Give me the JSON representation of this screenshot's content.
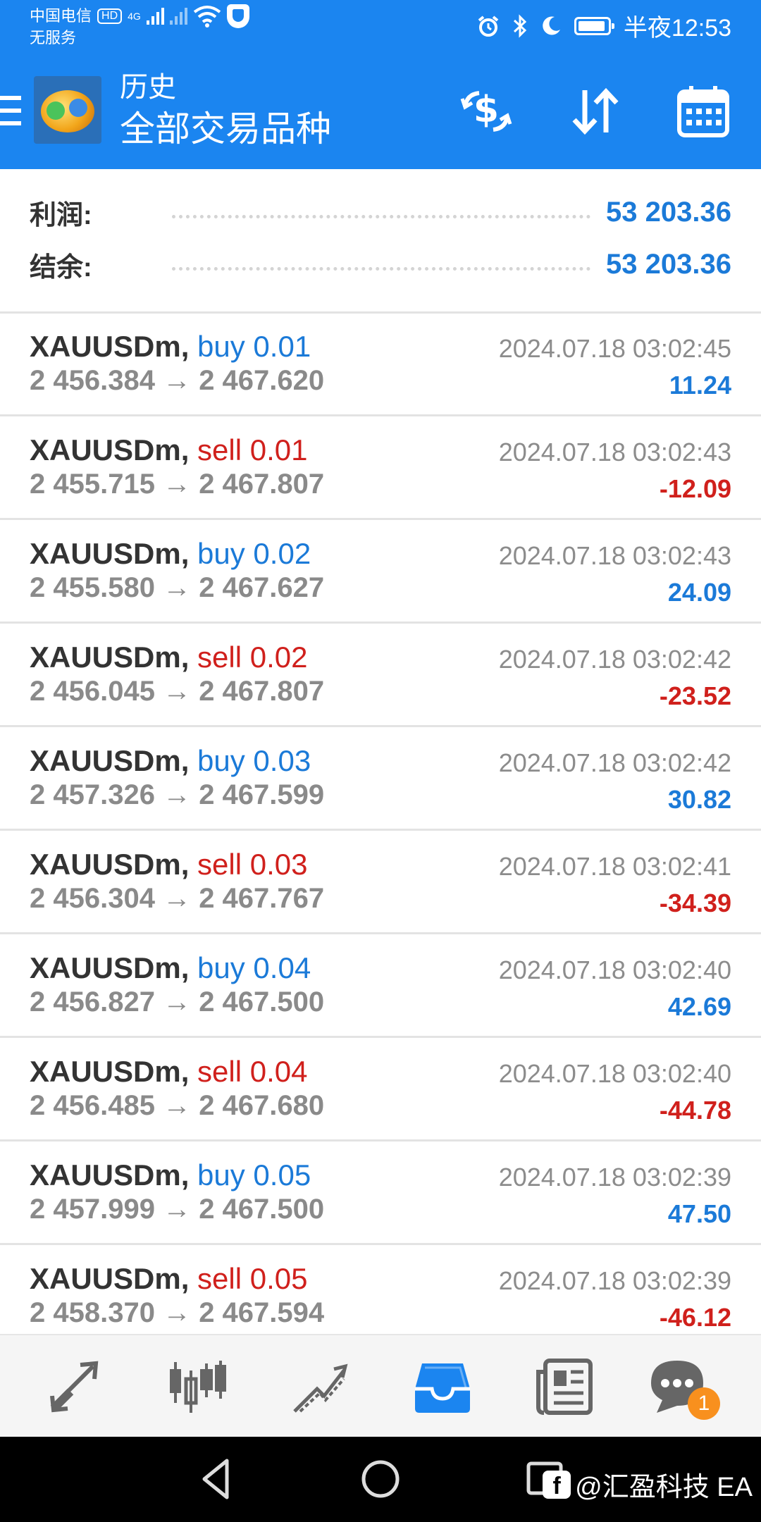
{
  "status_bar": {
    "carrier": "中国电信",
    "hd_badge": "HD",
    "net_type": "4G",
    "service": "无服务",
    "time": "半夜12:53"
  },
  "toolbar": {
    "title": "历史",
    "subtitle": "全部交易品种",
    "icons": [
      "menu-icon",
      "app-logo",
      "dollar-exchange-icon",
      "sort-icon",
      "calendar-icon"
    ]
  },
  "summary": {
    "profit_label": "利润:",
    "profit_value": "53 203.36",
    "balance_label": "结余:",
    "balance_value": "53 203.36"
  },
  "trades": [
    {
      "symbol": "XAUUSDm,",
      "side": "buy 0.01",
      "type": "buy",
      "open": "2 456.384",
      "close": "2 467.620",
      "time": "2024.07.18 03:02:45",
      "profit": "11.24"
    },
    {
      "symbol": "XAUUSDm,",
      "side": "sell 0.01",
      "type": "sell",
      "open": "2 455.715",
      "close": "2 467.807",
      "time": "2024.07.18 03:02:43",
      "profit": "-12.09"
    },
    {
      "symbol": "XAUUSDm,",
      "side": "buy 0.02",
      "type": "buy",
      "open": "2 455.580",
      "close": "2 467.627",
      "time": "2024.07.18 03:02:43",
      "profit": "24.09"
    },
    {
      "symbol": "XAUUSDm,",
      "side": "sell 0.02",
      "type": "sell",
      "open": "2 456.045",
      "close": "2 467.807",
      "time": "2024.07.18 03:02:42",
      "profit": "-23.52"
    },
    {
      "symbol": "XAUUSDm,",
      "side": "buy 0.03",
      "type": "buy",
      "open": "2 457.326",
      "close": "2 467.599",
      "time": "2024.07.18 03:02:42",
      "profit": "30.82"
    },
    {
      "symbol": "XAUUSDm,",
      "side": "sell 0.03",
      "type": "sell",
      "open": "2 456.304",
      "close": "2 467.767",
      "time": "2024.07.18 03:02:41",
      "profit": "-34.39"
    },
    {
      "symbol": "XAUUSDm,",
      "side": "buy 0.04",
      "type": "buy",
      "open": "2 456.827",
      "close": "2 467.500",
      "time": "2024.07.18 03:02:40",
      "profit": "42.69"
    },
    {
      "symbol": "XAUUSDm,",
      "side": "sell 0.04",
      "type": "sell",
      "open": "2 456.485",
      "close": "2 467.680",
      "time": "2024.07.18 03:02:40",
      "profit": "-44.78"
    },
    {
      "symbol": "XAUUSDm,",
      "side": "buy 0.05",
      "type": "buy",
      "open": "2 457.999",
      "close": "2 467.500",
      "time": "2024.07.18 03:02:39",
      "profit": "47.50"
    },
    {
      "symbol": "XAUUSDm,",
      "side": "sell 0.05",
      "type": "sell",
      "open": "2 458.370",
      "close": "2 467.594",
      "time": "2024.07.18 03:02:39",
      "profit": "-46.12"
    }
  ],
  "bottom_nav": {
    "items": [
      "quotes-icon",
      "chart-icon",
      "trade-icon",
      "history-icon",
      "news-icon",
      "chat-icon"
    ],
    "active": "history-icon",
    "chat_badge": "1"
  },
  "watermark": {
    "fb_letter": "f",
    "text": "@汇盈科技 EA"
  },
  "colors": {
    "primary": "#1b85f0",
    "profit_positive": "#1b7ad8",
    "profit_negative": "#d0201c",
    "badge": "#f8901e"
  }
}
